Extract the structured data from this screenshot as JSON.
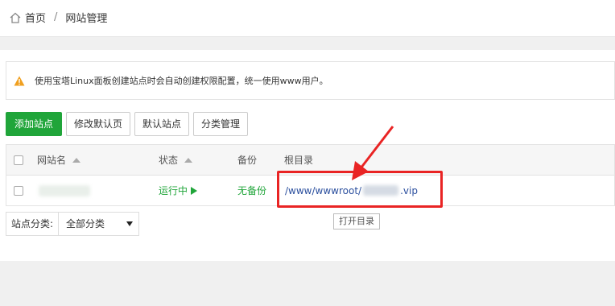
{
  "breadcrumb": {
    "home": "首页",
    "separator": "/",
    "current": "网站管理"
  },
  "notice": {
    "text": "使用宝塔Linux面板创建站点时会自动创建权限配置，统一使用www用户。"
  },
  "toolbar": {
    "add_site": "添加站点",
    "edit_default_page": "修改默认页",
    "default_site": "默认站点",
    "category_manage": "分类管理"
  },
  "table": {
    "headers": {
      "site_name": "网站名",
      "status": "状态",
      "backup": "备份",
      "root_dir": "根目录"
    },
    "rows": [
      {
        "status": "运行中",
        "backup": "无备份",
        "path_prefix": "/www/wwwroot/",
        "path_suffix": ".vip"
      }
    ]
  },
  "tooltip": {
    "text": "打开目录"
  },
  "filter": {
    "label": "站点分类:",
    "selected": "全部分类"
  },
  "colors": {
    "primary_green": "#20a53a",
    "highlight_red": "#e92424",
    "path_blue": "#2b4f9e",
    "warning_orange": "#f0a020"
  }
}
